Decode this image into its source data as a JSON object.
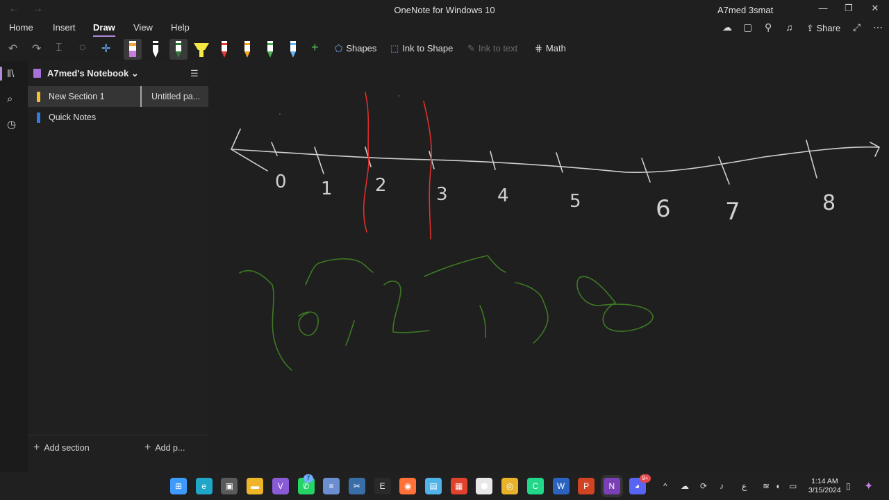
{
  "window": {
    "title": "OneNote for Windows 10",
    "user": "A7med 3smat",
    "back_arrow": "←",
    "forward_arrow": "→",
    "minimize": "—",
    "restore": "❐",
    "close": "✕"
  },
  "menu": {
    "items": [
      "Home",
      "Insert",
      "Draw",
      "View",
      "Help"
    ],
    "active": "Draw"
  },
  "header_actions": {
    "share_label": "Share",
    "more": "⋯"
  },
  "toolbar": {
    "shapes_label": "Shapes",
    "ink_to_shape_label": "Ink to Shape",
    "ink_to_text_label": "Ink to text",
    "math_label": "Math",
    "pen_colors": [
      "#c77be0",
      "#ffffff",
      "#2e7d32",
      "#f4e842",
      "#e53935",
      "#f5a623",
      "#4caf50",
      "#64b5f6"
    ],
    "add_pen": "+"
  },
  "navigation": {
    "notebook_name": "A7med's Notebook",
    "sections": [
      {
        "label": "New Section 1",
        "color": "#f2c230",
        "selected": true
      },
      {
        "label": "Quick Notes",
        "color": "#2f7fe0",
        "selected": false
      }
    ],
    "page": "Untitled pa...",
    "add_section": "Add section",
    "add_page": "Add p..."
  },
  "canvas": {
    "number_labels": [
      "0",
      "1",
      "2",
      "3",
      "4",
      "5",
      "6",
      "7",
      "8"
    ],
    "ink_colors": {
      "axis": "#d0d0d0",
      "red": "#e0302a",
      "green": "#3d7a22"
    }
  },
  "taskbar": {
    "apps": [
      {
        "name": "windows-start-icon",
        "color": "#3d9bff",
        "glyph": "⊞"
      },
      {
        "name": "edge-icon",
        "color": "#1fa6c9",
        "glyph": "e"
      },
      {
        "name": "store-icon",
        "color": "#5a5a5a",
        "glyph": "▣"
      },
      {
        "name": "file-explorer-icon",
        "color": "#f0b429",
        "glyph": "▬"
      },
      {
        "name": "visual-studio-icon",
        "color": "#8a5bd6",
        "glyph": "V"
      },
      {
        "name": "whatsapp-icon",
        "color": "#25d366",
        "glyph": "✆"
      },
      {
        "name": "notepad-icon",
        "color": "#6a8ecf",
        "glyph": "≡"
      },
      {
        "name": "snipping-icon",
        "color": "#3a6ea8",
        "glyph": "✂"
      },
      {
        "name": "epic-games-icon",
        "color": "#2a2a2a",
        "glyph": "E"
      },
      {
        "name": "firefox-icon",
        "color": "#ff7139",
        "glyph": "◉"
      },
      {
        "name": "notepad-plus-icon",
        "color": "#4fb3e8",
        "glyph": "▤"
      },
      {
        "name": "microsoft-apps-icon",
        "color": "#e2412c",
        "glyph": "▦"
      },
      {
        "name": "app-cube-icon",
        "color": "#e8e8e8",
        "glyph": "⬢"
      },
      {
        "name": "chrome-icon",
        "color": "#e8b32a",
        "glyph": "◎"
      },
      {
        "name": "clion-icon",
        "color": "#21d789",
        "glyph": "C"
      },
      {
        "name": "word-icon",
        "color": "#2b63c1",
        "glyph": "W"
      },
      {
        "name": "powerpoint-icon",
        "color": "#d04423",
        "glyph": "P"
      },
      {
        "name": "onenote-icon",
        "color": "#7b3fb6",
        "glyph": "N"
      },
      {
        "name": "discord-icon",
        "color": "#5865f2",
        "glyph": "◕"
      }
    ],
    "whatsapp_badge": "7",
    "discord_badge": "9+",
    "time": "1:14 AM",
    "date": "3/15/2024",
    "lang": "ع"
  }
}
